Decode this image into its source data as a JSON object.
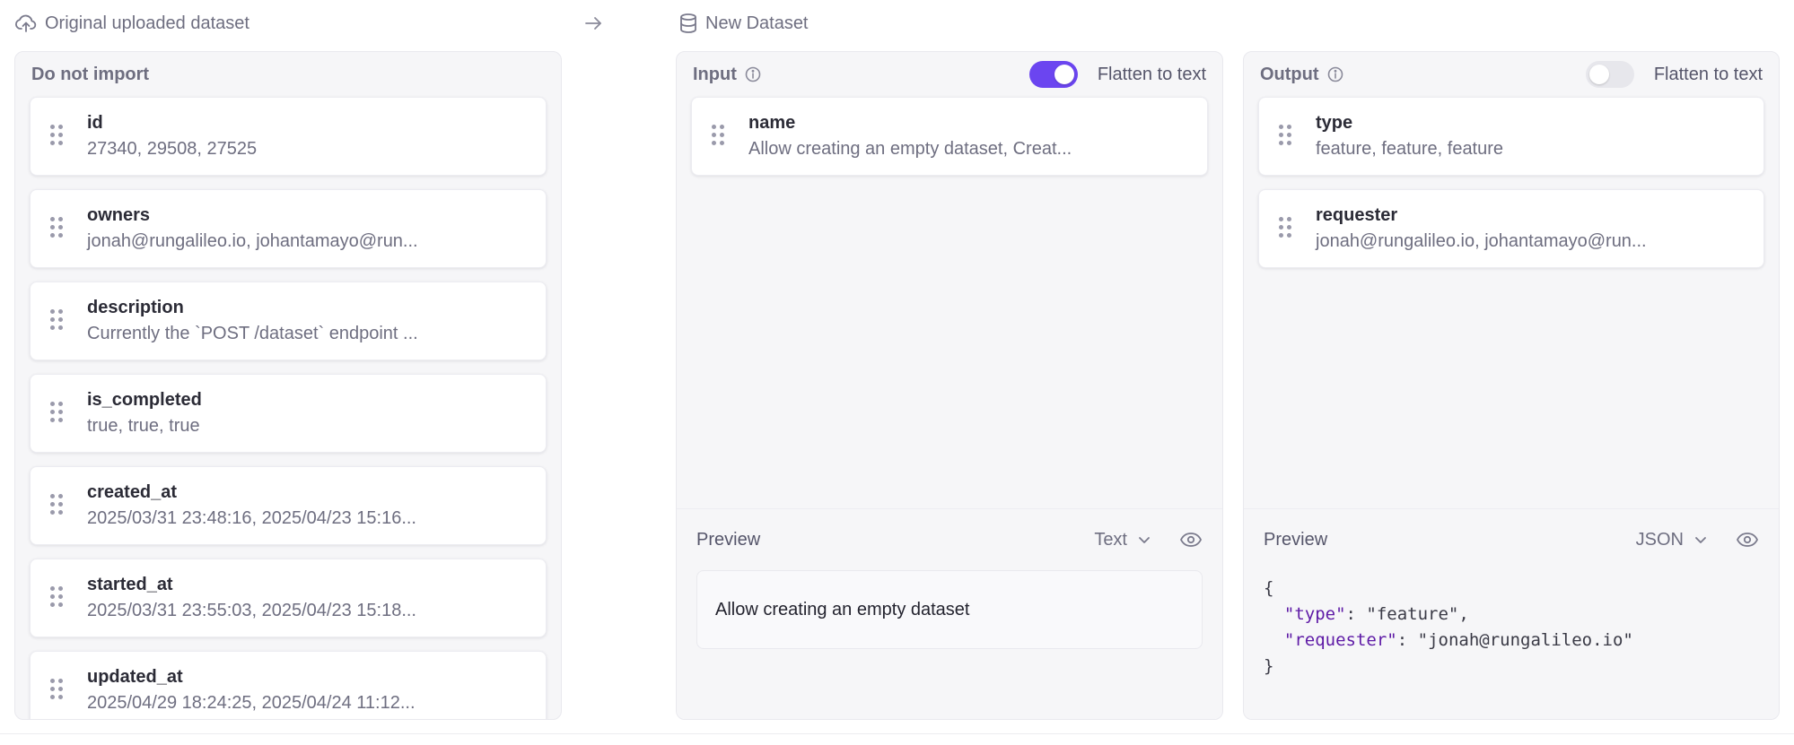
{
  "header": {
    "original_title": "Original uploaded dataset",
    "new_title": "New Dataset"
  },
  "left_panel": {
    "title": "Do not import",
    "columns": [
      {
        "name": "id",
        "values": "27340, 29508, 27525"
      },
      {
        "name": "owners",
        "values": "jonah@rungalileo.io, johantamayo@run..."
      },
      {
        "name": "description",
        "values": "Currently the `POST /dataset` endpoint ..."
      },
      {
        "name": "is_completed",
        "values": "true, true, true"
      },
      {
        "name": "created_at",
        "values": "2025/03/31 23:48:16, 2025/04/23 15:16..."
      },
      {
        "name": "started_at",
        "values": "2025/03/31 23:55:03, 2025/04/23 15:18..."
      },
      {
        "name": "updated_at",
        "values": "2025/04/29 18:24:25, 2025/04/24 11:12..."
      }
    ]
  },
  "input_panel": {
    "title": "Input",
    "flatten_label": "Flatten to text",
    "flatten_on": true,
    "columns": [
      {
        "name": "name",
        "values": "Allow creating an empty dataset, Creat..."
      }
    ],
    "preview": {
      "label": "Preview",
      "format": "Text",
      "content": "Allow creating an empty dataset"
    }
  },
  "output_panel": {
    "title": "Output",
    "flatten_label": "Flatten to text",
    "flatten_on": false,
    "columns": [
      {
        "name": "type",
        "values": "feature, feature, feature"
      },
      {
        "name": "requester",
        "values": "jonah@rungalileo.io, johantamayo@run..."
      }
    ],
    "preview": {
      "label": "Preview",
      "format": "JSON",
      "json_open": "{",
      "json_close": "}",
      "entries": [
        {
          "key": "\"type\"",
          "value": "\"feature\"",
          "sep": ","
        },
        {
          "key": "\"requester\"",
          "value": "\"jonah@rungalileo.io\"",
          "sep": ""
        }
      ]
    }
  },
  "colors": {
    "accent": "#6b45f0",
    "json_key": "#5e1aa6"
  }
}
